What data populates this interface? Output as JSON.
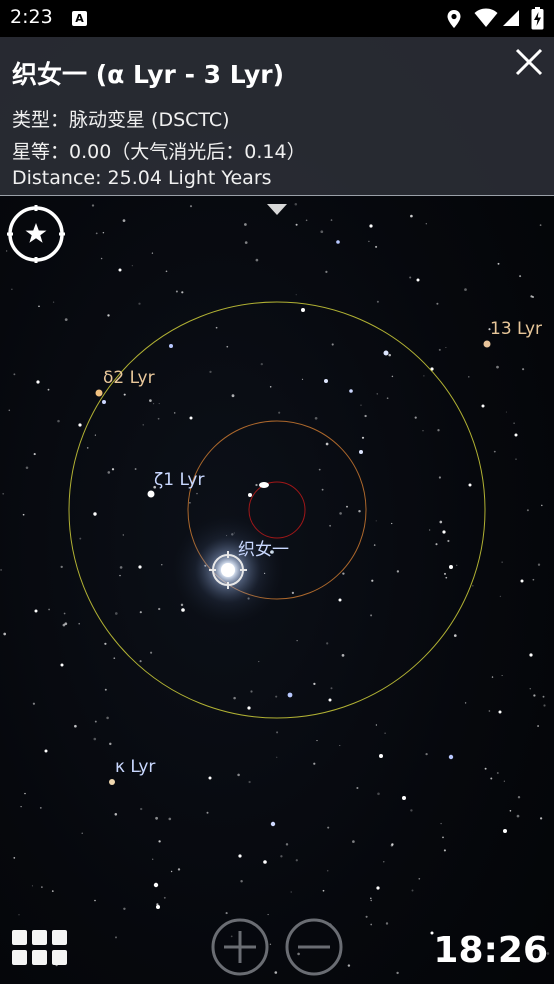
{
  "status_bar": {
    "time": "2:23",
    "notification_icon": "A",
    "icons": [
      "location-icon",
      "wifi-icon",
      "signal-icon",
      "battery-charging-icon"
    ]
  },
  "info_panel": {
    "title": "织女一 (α Lyr - 3 Lyr)",
    "type_line": "类型：脉动变星 (DSCTC)",
    "magnitude_line": "星等：0.00（大气消光后：0.14）",
    "distance_line": "Distance: 25.04 Light Years"
  },
  "sky_labels": {
    "star_13lyr": "13 Lyr",
    "star_delta2lyr": "δ2 Lyr",
    "star_zeta1lyr": "ζ1 Lyr",
    "star_vega": "织女一",
    "star_kappalyr": "κ Lyr"
  },
  "colors": {
    "label_warm": "#e8c79a",
    "label_cool": "#c9d8ff",
    "circle_outer": "#cfcf3a",
    "circle_middle": "#c97830",
    "circle_inner": "#b01818"
  },
  "bottom_bar": {
    "clock": "18:26"
  }
}
